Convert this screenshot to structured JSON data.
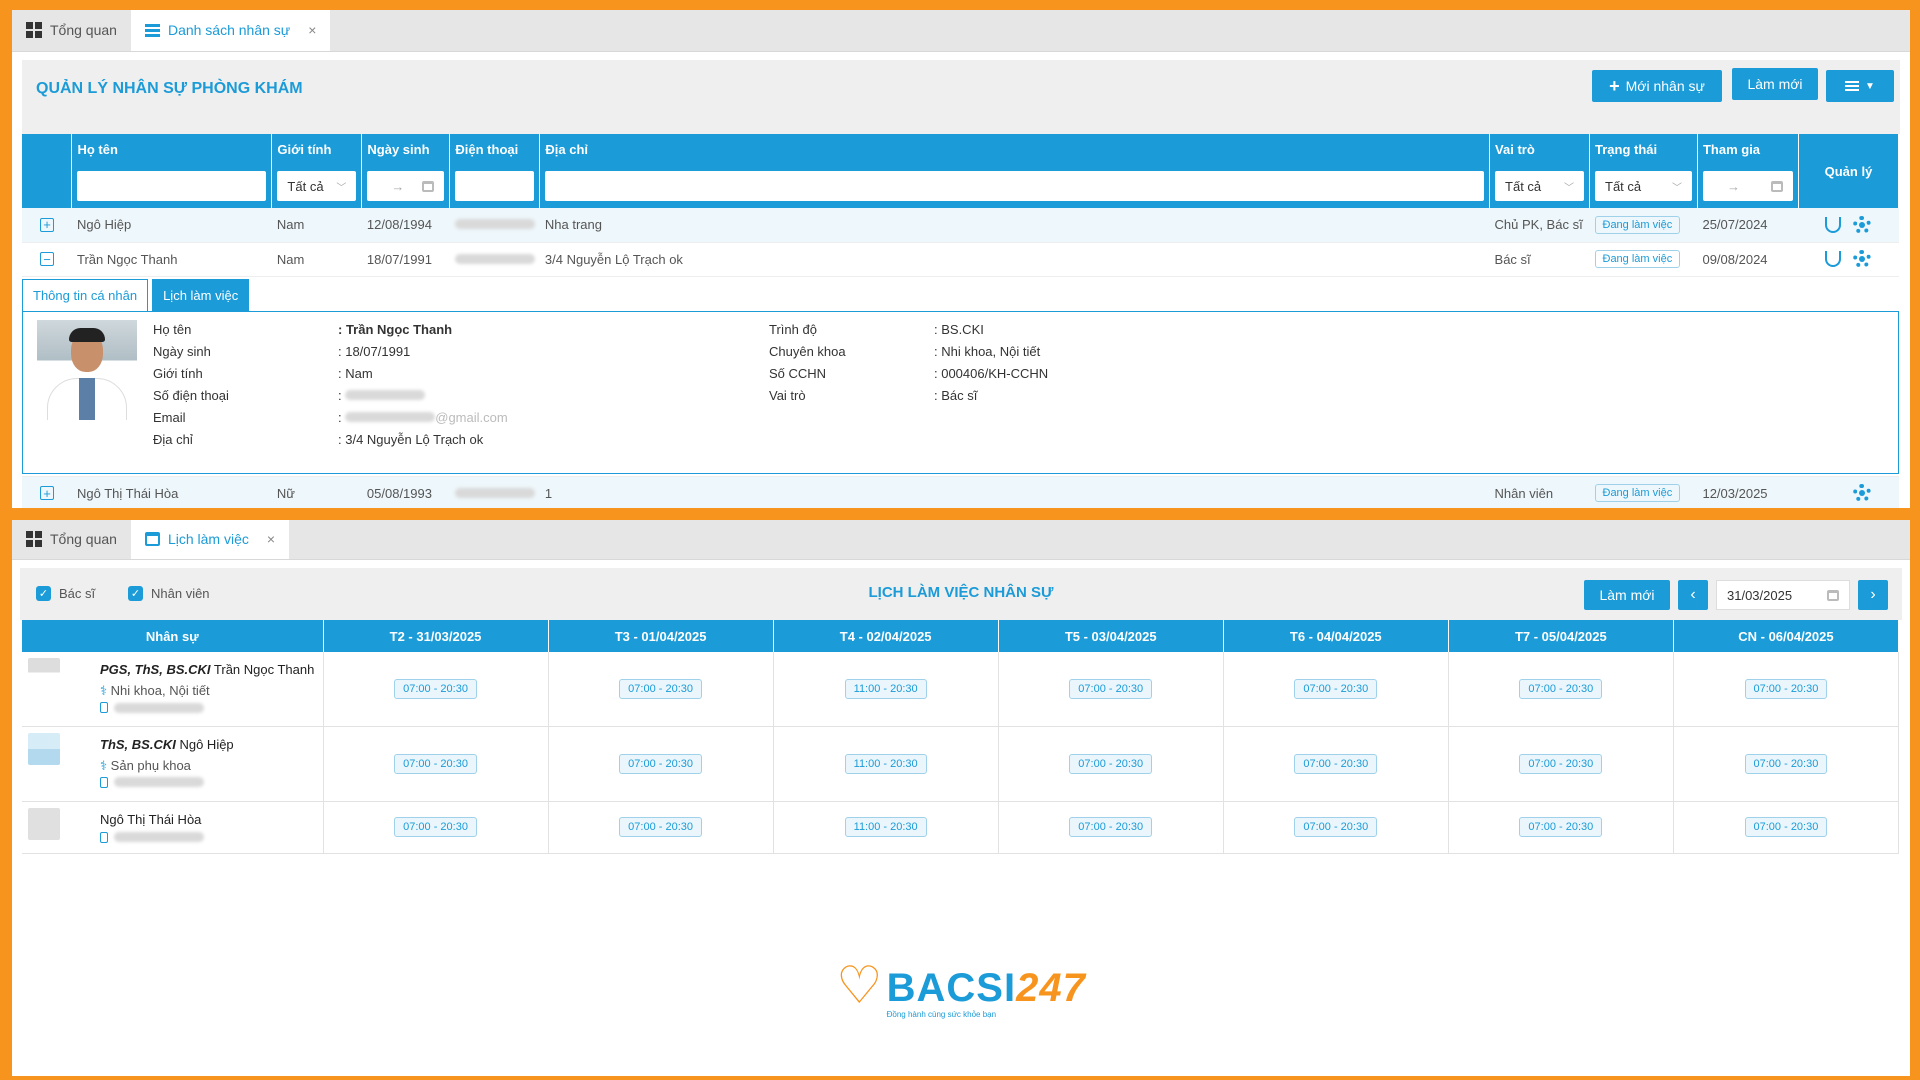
{
  "panel1": {
    "tabs": [
      {
        "label": "Tổng quan"
      },
      {
        "label": "Danh sách nhân sự",
        "close": "×"
      }
    ],
    "title": "QUẢN LÝ NHÂN SỰ PHÒNG KHÁM",
    "buttons": {
      "add": "Mới nhân sự",
      "refresh": "Làm mới"
    },
    "columns": {
      "name": "Họ tên",
      "gender": "Giới tính",
      "dob": "Ngày sinh",
      "phone": "Điện thoại",
      "address": "Địa chỉ",
      "role": "Vai trò",
      "status": "Trạng thái",
      "joined": "Tham gia",
      "manage": "Quản lý"
    },
    "filters": {
      "gender": "Tất cả",
      "role": "Tất cả",
      "status": "Tất cả",
      "range_arrow": "→"
    },
    "rows": [
      {
        "toggle": "+",
        "name": "Ngô Hiệp",
        "gender": "Nam",
        "dob": "12/08/1994",
        "address": "Nha trang",
        "role": "Chủ PK, Bác sĩ",
        "status": "Đang làm việc",
        "joined": "25/07/2024"
      },
      {
        "toggle": "−",
        "name": "Trần Ngọc Thanh",
        "gender": "Nam",
        "dob": "18/07/1991",
        "address": "3/4 Nguyễn Lộ Trạch ok",
        "role": "Bác sĩ",
        "status": "Đang làm việc",
        "joined": "09/08/2024"
      },
      {
        "toggle": "+",
        "name": "Ngô Thị Thái Hòa",
        "gender": "Nữ",
        "dob": "05/08/1993",
        "address": "1",
        "role": "Nhân viên",
        "status": "Đang làm việc",
        "joined": "12/03/2025"
      }
    ],
    "detail": {
      "tabs": [
        "Thông tin cá nhân",
        "Lịch làm việc"
      ],
      "left": [
        {
          "label": "Họ tên",
          "value": ": Trần Ngọc Thanh"
        },
        {
          "label": "Ngày sinh",
          "value": ": 18/07/1991"
        },
        {
          "label": "Giới tính",
          "value": ": Nam"
        },
        {
          "label": "Số điện thoại",
          "value": ":"
        },
        {
          "label": "Email",
          "value": ":"
        },
        {
          "label": "Địa chỉ",
          "value": ": 3/4 Nguyễn Lộ Trạch ok"
        }
      ],
      "email_suffix": "@gmail.com",
      "right": [
        {
          "label": "Trình độ",
          "value": ": BS.CKI"
        },
        {
          "label": "Chuyên khoa",
          "value": ": Nhi khoa, Nội tiết"
        },
        {
          "label": "Số CCHN",
          "value": ": 000406/KH-CCHN"
        },
        {
          "label": "Vai trò",
          "value": ": Bác sĩ"
        }
      ]
    }
  },
  "panel2": {
    "tabs": [
      {
        "label": "Tổng quan"
      },
      {
        "label": "Lịch làm việc",
        "close": "×"
      }
    ],
    "checkboxes": [
      {
        "label": "Bác sĩ",
        "checked": true
      },
      {
        "label": "Nhân viên",
        "checked": true
      }
    ],
    "title": "LỊCH LÀM VIỆC NHÂN SỰ",
    "refresh": "Làm mới",
    "date": "31/03/2025",
    "nav": {
      "prev": "‹",
      "next": "›"
    },
    "columns": [
      "Nhân sự",
      "T2 - 31/03/2025",
      "T3 - 01/04/2025",
      "T4 - 02/04/2025",
      "T5 - 03/04/2025",
      "T6 - 04/04/2025",
      "T7 - 05/04/2025",
      "CN - 06/04/2025"
    ],
    "staff": [
      {
        "title": "PGS, ThS, BS.CKI",
        "name": "Trần Ngọc Thanh",
        "specialty": "Nhi khoa, Nội tiết",
        "slots": [
          "07:00 - 20:30",
          "07:00 - 20:30",
          "11:00 - 20:30",
          "07:00 - 20:30",
          "07:00 - 20:30",
          "07:00 - 20:30",
          "07:00 - 20:30"
        ]
      },
      {
        "title": "ThS, BS.CKI",
        "name": "Ngô Hiệp",
        "specialty": "Sản phụ khoa",
        "slots": [
          "07:00 - 20:30",
          "07:00 - 20:30",
          "11:00 - 20:30",
          "07:00 - 20:30",
          "07:00 - 20:30",
          "07:00 - 20:30",
          "07:00 - 20:30"
        ]
      },
      {
        "title": "",
        "name": "Ngô Thị Thái Hòa",
        "specialty": "",
        "slots": [
          "07:00 - 20:30",
          "07:00 - 20:30",
          "11:00 - 20:30",
          "07:00 - 20:30",
          "07:00 - 20:30",
          "07:00 - 20:30",
          "07:00 - 20:30"
        ]
      }
    ]
  },
  "logo": {
    "brand": "BACSI",
    "brand_num": "247",
    "slogan": "Đồng hành cùng sức khỏe bạn"
  },
  "colors": {
    "primary": "#1b9bd7",
    "frame": "#f7941d"
  }
}
